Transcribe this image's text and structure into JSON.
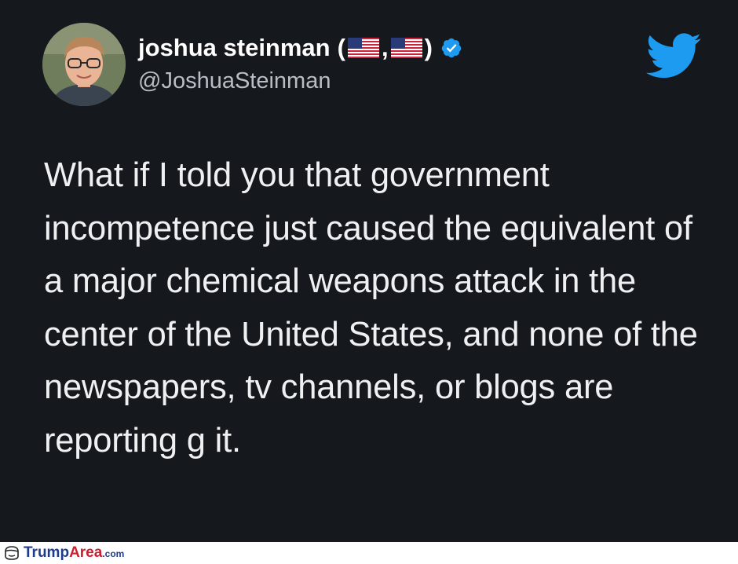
{
  "tweet": {
    "author_name": "joshua steinman",
    "name_open": "(",
    "name_separator": ",",
    "name_close": ")",
    "handle": "@JoshuaSteinman",
    "text": "What if I told you that government incompetence just caused the equivalent of a major chemical weapons attack in the center of the United States, and none of the newspapers, tv channels, or blogs are reporting g it.",
    "verified": true,
    "flags": [
      "us-flag",
      "us-flag"
    ]
  },
  "watermark": {
    "brand_part1": "Trump",
    "brand_part2": "Area",
    "brand_suffix": ".com"
  },
  "colors": {
    "background": "#15181c",
    "text": "#eef0f2",
    "handle": "#b9bec4",
    "twitter_blue": "#1d9bf0",
    "watermark_blue": "#1f3c8c",
    "watermark_red": "#c8202f"
  },
  "icons": {
    "avatar": "profile-photo",
    "verified": "verified-badge-icon",
    "logo": "twitter-bird-icon",
    "watermark": "trumparea-logo-icon"
  }
}
